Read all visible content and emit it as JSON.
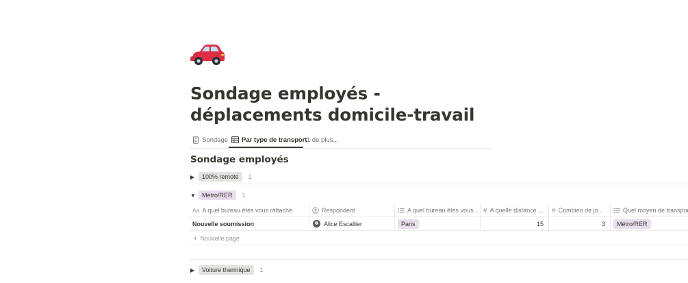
{
  "page": {
    "icon": "car-icon",
    "title": "Sondage employés - déplacements domicile-travail"
  },
  "tabs": [
    {
      "label": "Sondage",
      "icon": "document-icon"
    },
    {
      "label": "Par type de transport",
      "icon": "table-icon",
      "active": true
    },
    {
      "label": "1 de plus..."
    }
  ],
  "section_title": "Sondage employés",
  "groups": [
    {
      "label": "100% remote",
      "count": "1",
      "expanded": false,
      "color": "#e3e2e0"
    },
    {
      "label": "Métro/RER",
      "count": "1",
      "expanded": true,
      "color": "#e8deee"
    },
    {
      "label": "Voiture thermique",
      "count": "1",
      "expanded": false,
      "color": "#e3e2e0"
    }
  ],
  "columns": [
    {
      "label": "A quel bureau êtes vous rattaché",
      "icon": "title-icon"
    },
    {
      "label": "Respondent",
      "icon": "person-icon"
    },
    {
      "label": "A quel bureau êtes vous...",
      "icon": "list-icon"
    },
    {
      "label": "A quelle distance ...",
      "icon": "hash-icon"
    },
    {
      "label": "Combien de jo...",
      "icon": "hash-icon"
    },
    {
      "label": "Quel moyen de transpor...",
      "icon": "list-icon"
    }
  ],
  "row": {
    "name": "Nouvelle soumission",
    "respondent": "Alice Escallier",
    "office": "Paris",
    "distance": "15",
    "days": "3",
    "transport": "Métro/RER"
  },
  "new_page_label": "Nouvelle page",
  "colors": {
    "text": "#37352f",
    "muted": "#9b9a97",
    "tag_gray": "#e3e2e0",
    "tag_purple": "#e8deee",
    "car_red": "#dd2e44"
  }
}
